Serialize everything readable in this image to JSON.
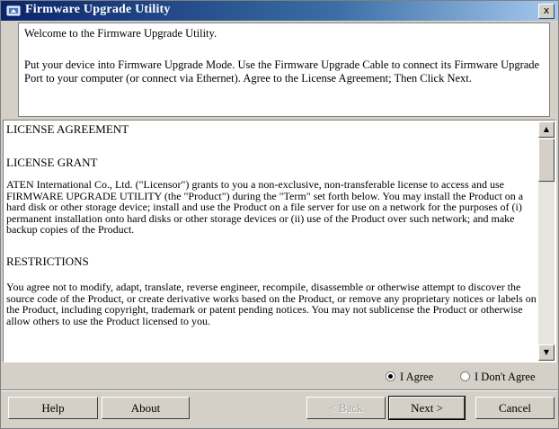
{
  "window": {
    "title": "Firmware Upgrade Utility",
    "close_label": "x"
  },
  "intro": {
    "welcome": "Welcome to the Firmware Upgrade Utility.",
    "instructions": "Put your device into Firmware Upgrade Mode. Use the Firmware Upgrade Cable to connect its Firmware Upgrade Port to your computer (or connect via Ethernet). Agree to the License Agreement; Then Click Next."
  },
  "license": {
    "heading": "LICENSE AGREEMENT",
    "grant_heading": "LICENSE GRANT",
    "grant_text": "ATEN International Co., Ltd. (\"Licensor\") grants to you a non-exclusive, non-transferable license to access and use FIRMWARE UPGRADE UTILITY (the \"Product\") during the \"Term\" set forth below. You may install the Product on a hard disk or other storage device; install and use the Product on a file server for use on a network for the purposes of (i) permanent installation onto hard disks or other storage devices or (ii) use of the Product over such network; and make backup copies of the Product.",
    "restrictions_heading": "RESTRICTIONS",
    "restrictions_text": "You agree not to modify, adapt, translate, reverse engineer, recompile, disassemble or otherwise attempt to discover the source code of the Product, or create derivative works based on the Product, or remove any proprietary notices or labels on the Product, including copyright, trademark or patent pending notices. You may not sublicense the Product or otherwise allow others to use the Product licensed to you."
  },
  "scrollbar": {
    "up_glyph": "▲",
    "down_glyph": "▼"
  },
  "agreement": {
    "agree_label": "I Agree",
    "disagree_label": "I Don't Agree",
    "selected": "agree"
  },
  "buttons": {
    "help": "Help",
    "about": "About",
    "back": "< Back",
    "next": "Next >",
    "cancel": "Cancel"
  }
}
